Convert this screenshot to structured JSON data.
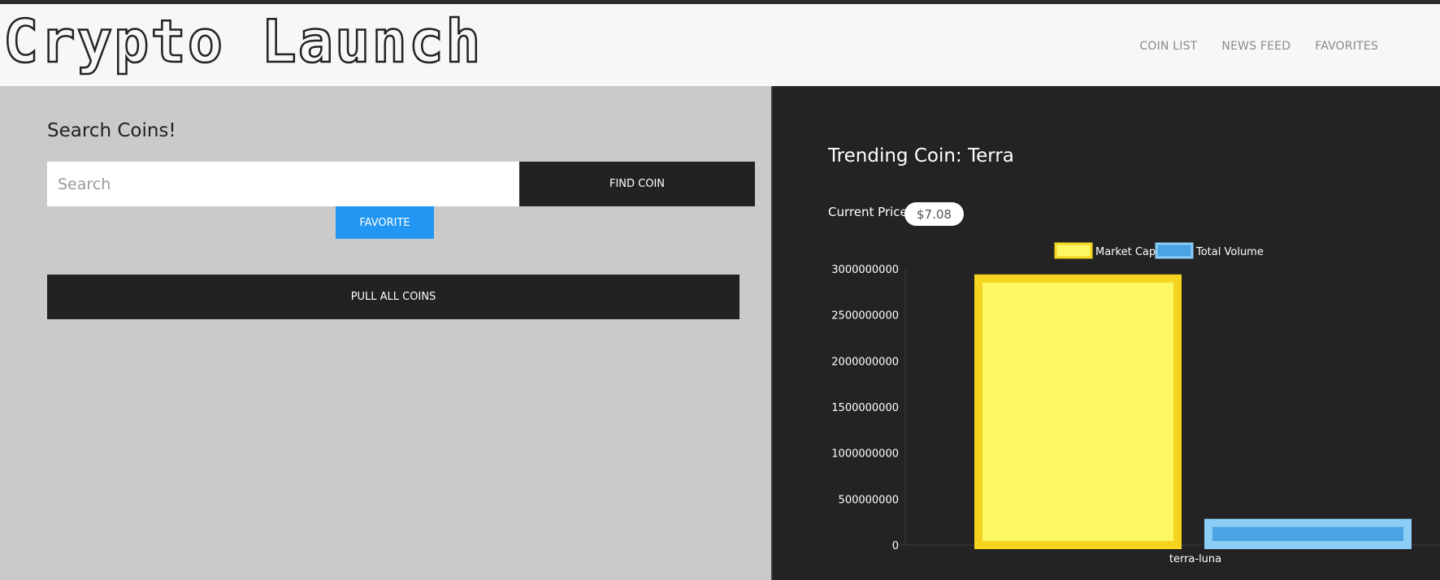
{
  "app": {
    "logo": "Crypto Launch",
    "nav": [
      "COIN LIST",
      "NEWS FEED",
      "FAVORITES"
    ]
  },
  "search": {
    "title": "Search Coins!",
    "placeholder": "Search",
    "find_label": "FIND COIN",
    "favorite_label": "FAVORITE",
    "pull_label": "PULL ALL COINS"
  },
  "trending": {
    "title": "Trending Coin: Terra",
    "price_label": "Current Price:",
    "price": "$7.08"
  },
  "colors": {
    "market_cap_fill": "#fdf764",
    "market_cap_border": "#f5d41f",
    "volume_fill": "#4aa3e3",
    "volume_border": "#8ccdf5"
  },
  "chart_data": {
    "type": "bar",
    "categories": [
      "terra-luna"
    ],
    "series": [
      {
        "name": "Market Cap",
        "values": [
          2940000000
        ]
      },
      {
        "name": "Total Volume",
        "values": [
          285000000
        ]
      }
    ],
    "y_ticks": [
      "0",
      "500000000",
      "1000000000",
      "1500000000",
      "2000000000",
      "2500000000",
      "3000000000"
    ],
    "ylim": [
      0,
      3000000000
    ],
    "legend": "top-center",
    "grid": false
  }
}
